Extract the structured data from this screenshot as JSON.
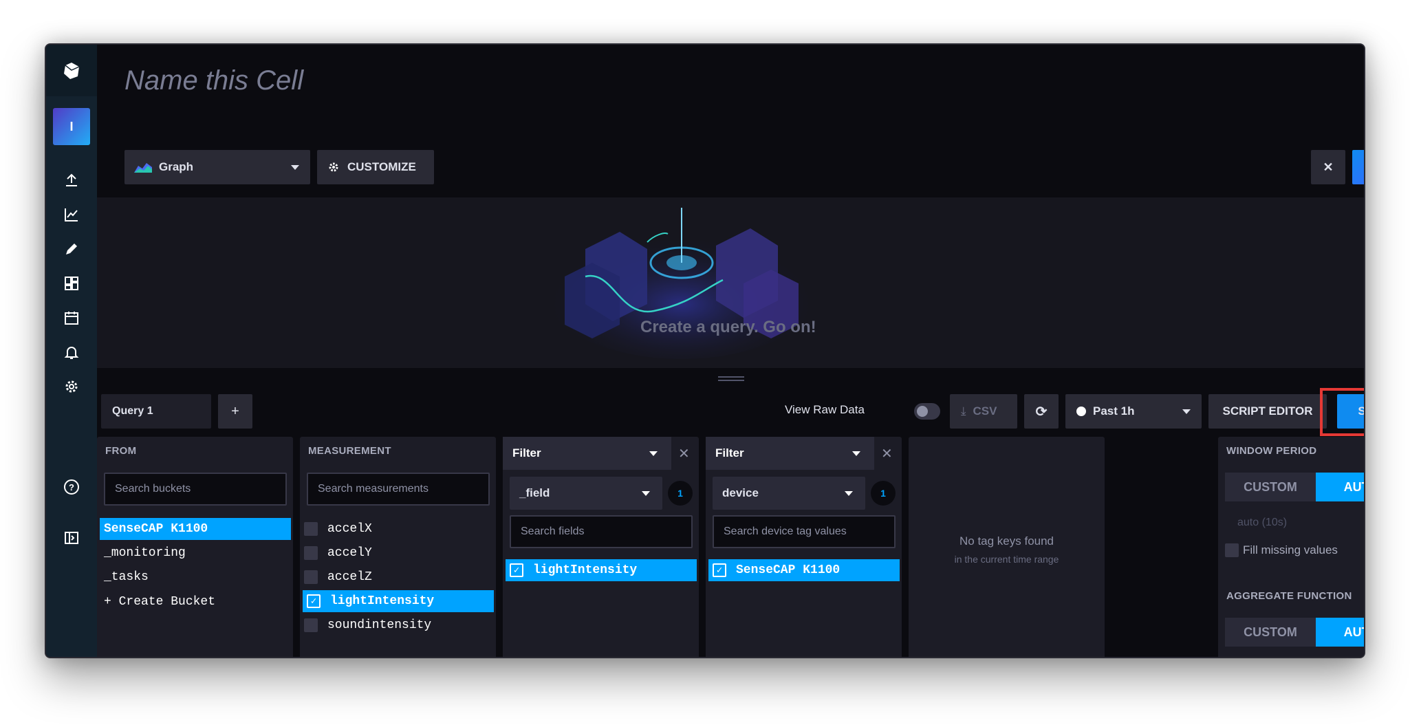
{
  "app": {
    "cell_title_placeholder": "Name this Cell"
  },
  "toolbar": {
    "vis_type": "Graph",
    "customize_label": "CUSTOMIZE"
  },
  "preview": {
    "empty_text": "Create a query. Go on!"
  },
  "query_bar": {
    "query_tab": "Query 1",
    "add_label": "+",
    "view_raw_label": "View Raw Data",
    "csv_label": "CSV",
    "time_range": "Past 1h",
    "script_editor_label": "SCRIPT EDITOR",
    "submit_label": "SUBMIT"
  },
  "from": {
    "header": "FROM",
    "search_placeholder": "Search buckets",
    "items": [
      "SenseCAP K1100",
      "_monitoring",
      "_tasks",
      "+ Create Bucket"
    ]
  },
  "measurement": {
    "header": "MEASUREMENT",
    "search_placeholder": "Search measurements",
    "items": [
      "accelX",
      "accelY",
      "accelZ",
      "lightIntensity",
      "soundintensity"
    ]
  },
  "filter1": {
    "header": "Filter",
    "key": "_field",
    "count": "1",
    "search_placeholder": "Search fields",
    "items": [
      "lightIntensity"
    ]
  },
  "filter2": {
    "header": "Filter",
    "key": "device",
    "count": "1",
    "search_placeholder": "Search device tag values",
    "items": [
      "SenseCAP K1100"
    ]
  },
  "empty_filter": {
    "title": "No tag keys found",
    "subtitle": "in the current time range"
  },
  "window_period": {
    "header": "WINDOW PERIOD",
    "custom_label": "CUSTOM",
    "auto_label": "AUTO",
    "auto_value": "auto (10s)",
    "fill_missing_label": "Fill missing values",
    "help": "?"
  },
  "aggregate": {
    "header": "AGGREGATE FUNCTION",
    "custom_label": "CUSTOM",
    "auto_label": "AUTO"
  },
  "colors": {
    "accent": "#00a3ff",
    "submit": "#0f8bf0",
    "highlight_box": "#e53935"
  }
}
